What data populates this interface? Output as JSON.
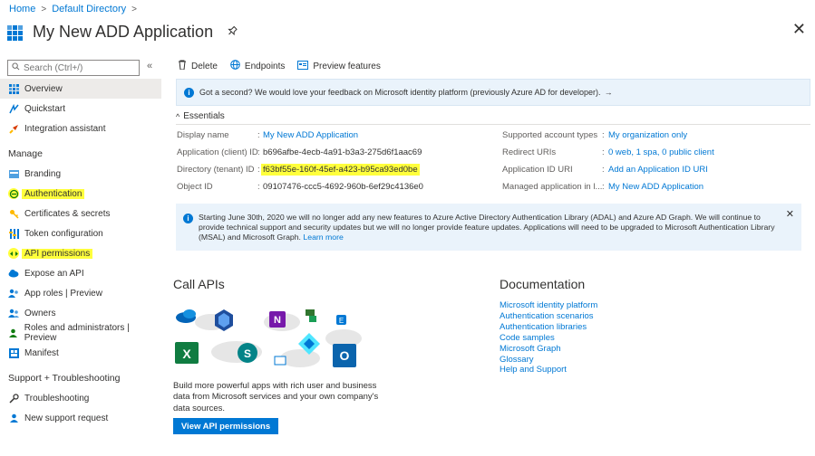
{
  "breadcrumb": {
    "home": "Home",
    "sep1": ">",
    "directory": "Default Directory",
    "sep2": ">"
  },
  "header": {
    "title": "My New ADD Application",
    "pin_icon": "pin-icon",
    "close": "✕"
  },
  "sidebar": {
    "search_placeholder": "Search (Ctrl+/)",
    "collapse": "«",
    "items": [
      {
        "label": "Overview",
        "icon": "overview-icon",
        "color": "#0078d4"
      },
      {
        "label": "Quickstart",
        "icon": "quickstart-icon",
        "color": "#0078d4"
      },
      {
        "label": "Integration assistant",
        "icon": "rocket-icon",
        "color": "#d83b01"
      }
    ],
    "manage_header": "Manage",
    "manage_items": [
      {
        "label": "Branding",
        "icon": "branding-icon"
      },
      {
        "label": "Authentication",
        "icon": "authentication-icon"
      },
      {
        "label": "Certificates & secrets",
        "icon": "key-icon"
      },
      {
        "label": "Token configuration",
        "icon": "token-icon"
      },
      {
        "label": "API permissions",
        "icon": "api-permissions-icon"
      },
      {
        "label": "Expose an API",
        "icon": "cloud-icon"
      },
      {
        "label": "App roles | Preview",
        "icon": "app-roles-icon"
      },
      {
        "label": "Owners",
        "icon": "owners-icon"
      },
      {
        "label": "Roles and administrators | Preview",
        "icon": "roles-icon"
      },
      {
        "label": "Manifest",
        "icon": "manifest-icon"
      }
    ],
    "support_header": "Support + Troubleshooting",
    "support_items": [
      {
        "label": "Troubleshooting",
        "icon": "wrench-icon"
      },
      {
        "label": "New support request",
        "icon": "support-icon"
      }
    ],
    "highlight_color": "#ffff3c"
  },
  "toolbar": {
    "delete": "Delete",
    "endpoints": "Endpoints",
    "preview": "Preview features"
  },
  "feedback": {
    "text": "Got a second? We would love your feedback on Microsoft identity platform (previously Azure AD for developer).",
    "arrow": "→"
  },
  "essentials": {
    "label": "Essentials",
    "chevron": "^",
    "left": [
      {
        "key": "Display name",
        "value": "My New ADD Application",
        "link": true
      },
      {
        "key": "Application (client) ID",
        "value": "b696afbe-4ecb-4a91-b3a3-275d6f1aac69",
        "link": false
      },
      {
        "key": "Directory (tenant) ID",
        "value": "f63bf55e-160f-45ef-a423-b95ca93ed0be",
        "link": false
      },
      {
        "key": "Object ID",
        "value": "09107476-ccc5-4692-960b-6ef29c4136e0",
        "link": false
      }
    ],
    "right": [
      {
        "key": "Supported account types",
        "value": "My organization only"
      },
      {
        "key": "Redirect URIs",
        "value": "0 web, 1 spa, 0 public client"
      },
      {
        "key": "Application ID URI",
        "value": "Add an Application ID URI"
      },
      {
        "key": "Managed application in l...",
        "value": "My New ADD Application"
      }
    ]
  },
  "notice": {
    "text": "Starting June 30th, 2020 we will no longer add any new features to Azure Active Directory Authentication Library (ADAL) and Azure AD Graph. We will continue to provide technical support and security updates but we will no longer provide feature updates. Applications will need to be upgraded to Microsoft Authentication Library (MSAL) and Microsoft Graph.",
    "link": "Learn more",
    "close": "✕"
  },
  "call_apis": {
    "title": "Call APIs",
    "description": "Build more powerful apps with rich user and business data from Microsoft services and your own company's data sources.",
    "button": "View API permissions",
    "logo_letters": {
      "onenote": "N",
      "excel": "X",
      "sharepoint": "S",
      "outlook": "O",
      "exchange": "E"
    }
  },
  "documentation": {
    "title": "Documentation",
    "links": [
      "Microsoft identity platform",
      "Authentication scenarios",
      "Authentication libraries",
      "Code samples",
      "Microsoft Graph",
      "Glossary",
      "Help and Support"
    ]
  },
  "colors": {
    "accent": "#0078d4",
    "banner": "#eaf3fb",
    "highlight": "#ffff3c"
  }
}
